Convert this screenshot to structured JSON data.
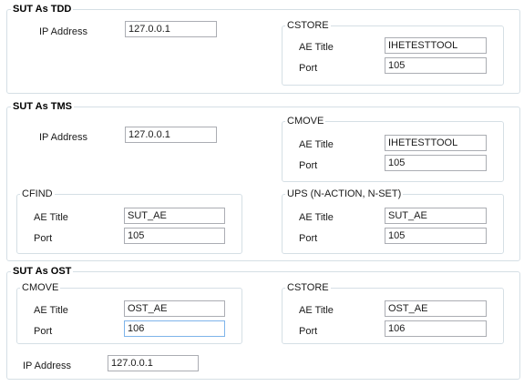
{
  "tdd": {
    "title": "SUT As TDD",
    "ip_label": "IP Address",
    "ip_value": "127.0.0.1",
    "cstore": {
      "title": "CSTORE",
      "ae_label": "AE Title",
      "ae_value": "IHETESTTOOL",
      "port_label": "Port",
      "port_value": "105"
    }
  },
  "tms": {
    "title": "SUT As TMS",
    "ip_label": "IP Address",
    "ip_value": "127.0.0.1",
    "cmove": {
      "title": "CMOVE",
      "ae_label": "AE Title",
      "ae_value": "IHETESTTOOL",
      "port_label": "Port",
      "port_value": "105"
    },
    "cfind": {
      "title": "CFIND",
      "ae_label": "AE Title",
      "ae_value": "SUT_AE",
      "port_label": "Port",
      "port_value": "105"
    },
    "ups": {
      "title": "UPS (N-ACTION, N-SET)",
      "ae_label": "AE Title",
      "ae_value": "SUT_AE",
      "port_label": "Port",
      "port_value": "105"
    }
  },
  "ost": {
    "title": "SUT As OST",
    "ip_label": "IP Address",
    "ip_value": "127.0.0.1",
    "cmove": {
      "title": "CMOVE",
      "ae_label": "AE Title",
      "ae_value": "OST_AE",
      "port_label": "Port",
      "port_value": "106"
    },
    "cstore": {
      "title": "CSTORE",
      "ae_label": "AE Title",
      "ae_value": "OST_AE",
      "port_label": "Port",
      "port_value": "106"
    }
  },
  "colors": {
    "group_border": "#d5dfe5",
    "field_border": "#abadb3",
    "focused_border": "#7eb4ea"
  }
}
